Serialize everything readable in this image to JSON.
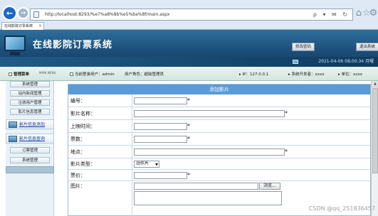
{
  "browser": {
    "address": "http://localhost:8293/%e7%a8%8b%e5%ba%8f/main.aspx",
    "tab_title": "在线影院订票系统",
    "tab_close": "×",
    "back_glyph": "←",
    "forward_glyph": "→",
    "address_actions": "ρ ▾ ✉ ↻",
    "icons": [
      "home-icon",
      "star-icon",
      "gear-icon"
    ]
  },
  "header": {
    "title": "在线影院订票系统",
    "change_password_label": "修改密码",
    "logout_label": "退出系统",
    "datetime": "2021-04-06 08:00:34 月曜"
  },
  "status": {
    "menu_label": "管理菜单",
    "menu_sub": "MAIN MENU",
    "current_user": "当前登录用户：admin",
    "user_role": "用户角色：超级管理员",
    "ip": "▸ IP：127.0.0.1",
    "developer": "▸ 系统开发者：xxxx",
    "unit": "▸ 单位：xxxx"
  },
  "sidebar": {
    "top_items": [
      {
        "label": "系统管理"
      },
      {
        "label": "站内新闻管理"
      },
      {
        "label": "注册用户管理"
      },
      {
        "label": "影片信息管理"
      }
    ],
    "group1": {
      "label": "影片信息添加"
    },
    "group2": {
      "label": "影片信息查询"
    },
    "bottom_items": [
      {
        "label": "订票管理"
      },
      {
        "label": "系统管理"
      }
    ]
  },
  "form": {
    "title": "添加影片",
    "required_mark": "*",
    "fields": {
      "id": {
        "label": "编号：",
        "value": ""
      },
      "name": {
        "label": "影片名称：",
        "value": ""
      },
      "release": {
        "label": "上映时间：",
        "value": ""
      },
      "tickets": {
        "label": "票数：",
        "value": ""
      },
      "venue": {
        "label": "地点：",
        "value": ""
      },
      "genre": {
        "label": "影片类型：",
        "value": "动作片"
      },
      "price": {
        "label": "票价：",
        "value": ""
      },
      "image": {
        "label": "图片：",
        "browse_label": "浏览..."
      }
    }
  },
  "watermark": "CSDN @qq_251836457",
  "colors": {
    "header": "#1d4f7a",
    "form_title": "#5b9bd5",
    "status": "#d3e6dd"
  }
}
